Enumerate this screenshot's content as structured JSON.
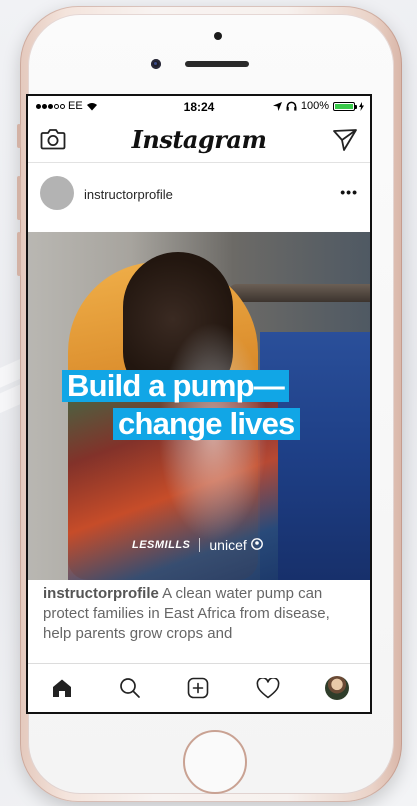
{
  "status_bar": {
    "carrier": "EE",
    "time": "18:24",
    "battery_percent": "100%"
  },
  "nav": {
    "logo": "Instagram",
    "left_icon": "camera-icon",
    "right_icon": "direct-message-icon"
  },
  "post": {
    "username": "instructorprofile",
    "more": "•••",
    "image": {
      "headline_line1": "Build a pump—",
      "headline_line2": "change lives",
      "brand_left": "LESMILLS",
      "brand_right": "unicef"
    },
    "caption_user": "instructorprofile",
    "caption_text": " A clean water pump can protect families in East Africa from disease, help parents grow crops and"
  },
  "tab_bar": {
    "items": [
      "home-icon",
      "search-icon",
      "add-post-icon",
      "activity-heart-icon",
      "profile-avatar"
    ]
  },
  "colors": {
    "headline_bg": "#11a6e6",
    "phone_accent": "#d9b6a8",
    "battery": "#39c94a"
  }
}
